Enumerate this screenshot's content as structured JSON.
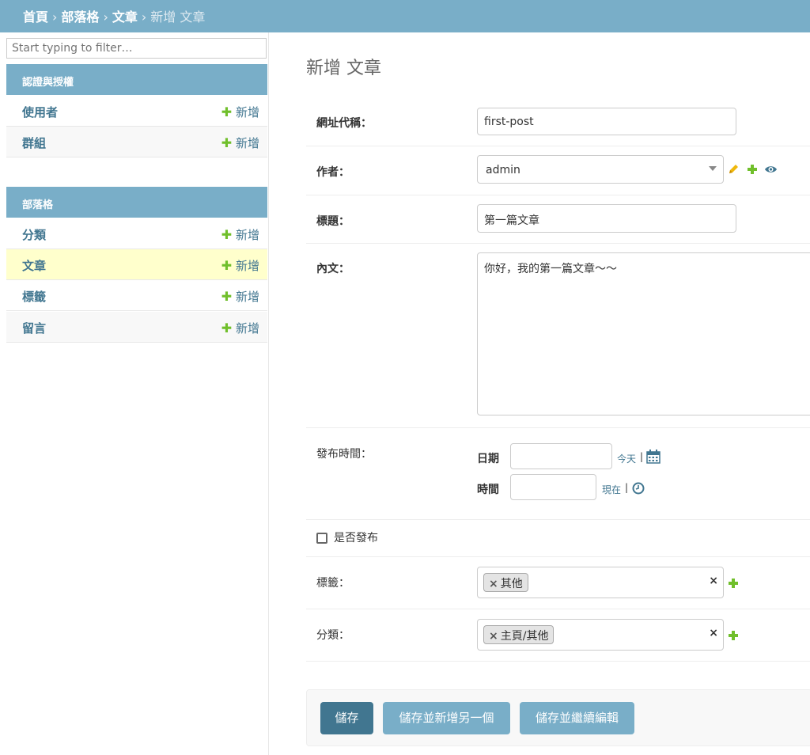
{
  "breadcrumbs": {
    "home": "首頁",
    "app": "部落格",
    "model": "文章",
    "current": "新增 文章",
    "separator": "›"
  },
  "sidebar": {
    "filter_placeholder": "Start typing to filter…",
    "modules": [
      {
        "caption": "認證與授權",
        "items": [
          {
            "label": "使用者",
            "add": "新增"
          },
          {
            "label": "群組",
            "add": "新增"
          }
        ]
      },
      {
        "caption": "部落格",
        "items": [
          {
            "label": "分類",
            "add": "新增"
          },
          {
            "label": "文章",
            "add": "新增"
          },
          {
            "label": "標籤",
            "add": "新增"
          },
          {
            "label": "留言",
            "add": "新增"
          }
        ]
      }
    ],
    "plus_glyph": "✚"
  },
  "form": {
    "title": "新增 文章",
    "slug": {
      "label": "網址代稱：",
      "value": "first-post"
    },
    "author": {
      "label": "作者：",
      "value": "admin"
    },
    "heading": {
      "label": "標題：",
      "value": "第一篇文章"
    },
    "body": {
      "label": "內文：",
      "value": "你好，我的第一篇文章～～"
    },
    "publish_time": {
      "label": "發布時間：",
      "date_label": "日期",
      "time_label": "時間",
      "today": "今天",
      "now": "現在",
      "pipe": "|"
    },
    "published": {
      "label": "是否發布",
      "checked": false
    },
    "tags": {
      "label": "標籤：",
      "chips": [
        "其他"
      ]
    },
    "category": {
      "label": "分類：",
      "chips": [
        "主頁/其他"
      ]
    },
    "remove_glyph": "×"
  },
  "buttons": {
    "save": "儲存",
    "save_add_another": "儲存並新增另一個",
    "save_continue": "儲存並繼續編輯"
  },
  "colors": {
    "header": "#79aec8",
    "link": "#417690",
    "add_green": "#70bf2b",
    "selected_row": "#ffffcc",
    "button_primary": "#417690",
    "button_secondary": "#79aec8",
    "pencil": "#efb80b"
  }
}
